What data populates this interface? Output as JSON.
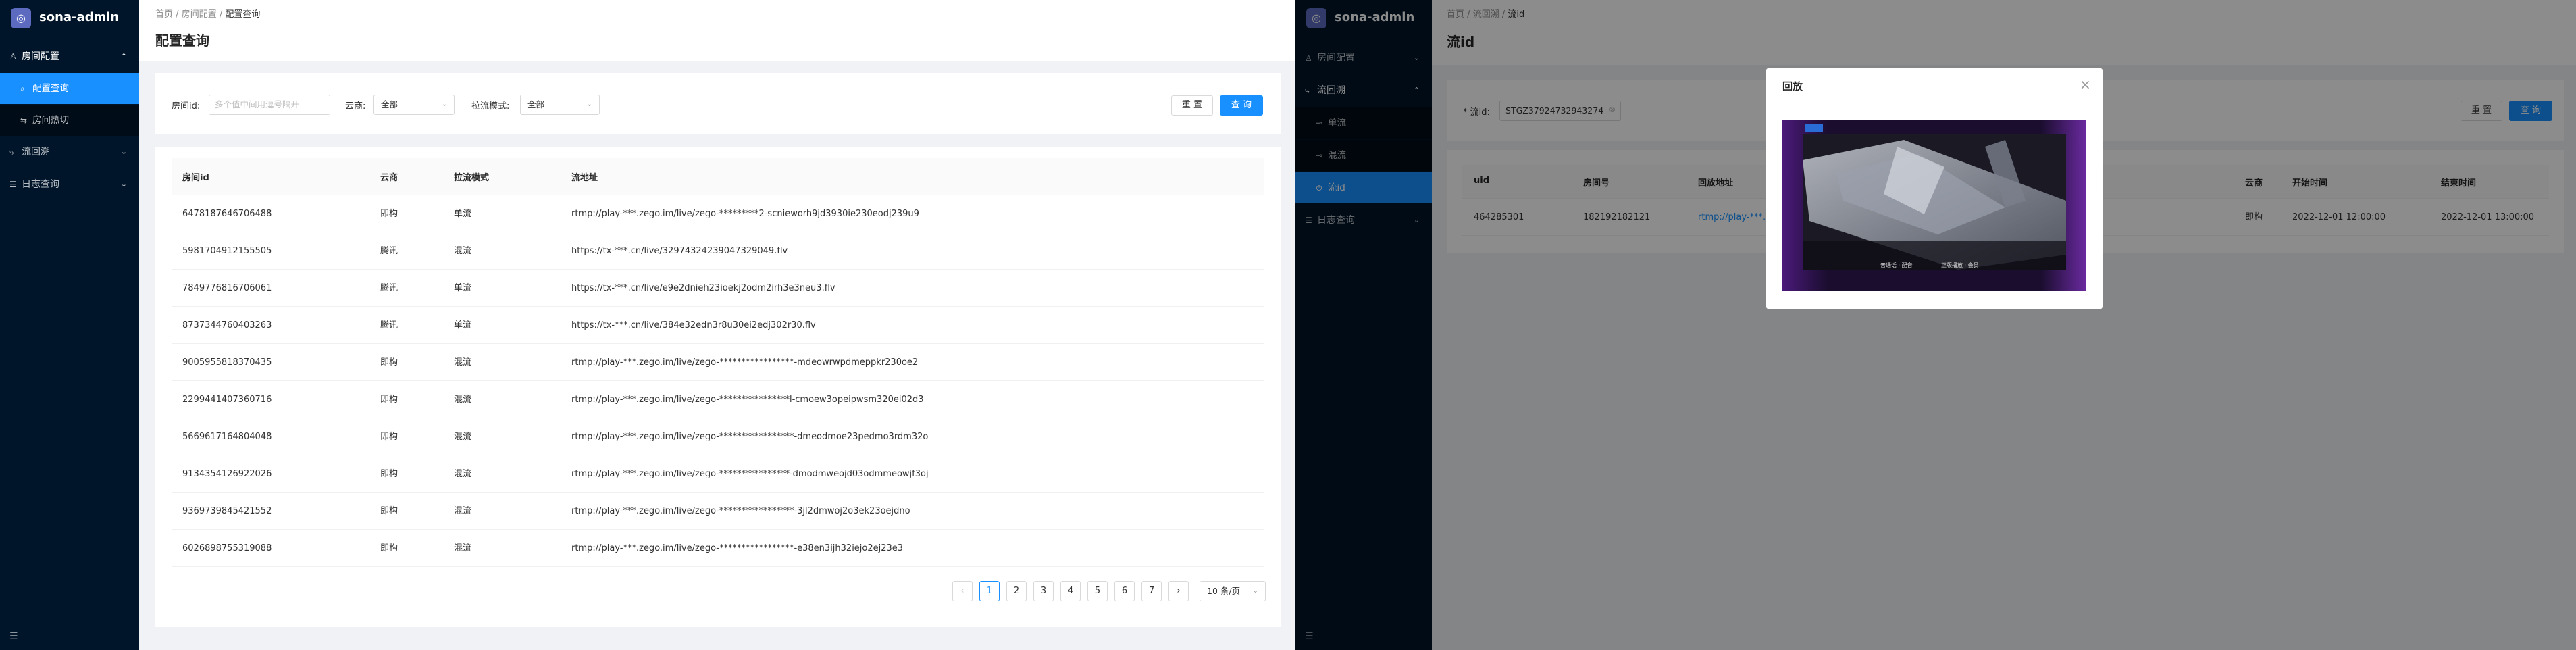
{
  "app": {
    "name": "sona-admin",
    "logo_glyph": "◎"
  },
  "left": {
    "menu": [
      {
        "label": "房间配置",
        "icon": "♙",
        "arrow": "⌃"
      },
      {
        "label": "配置查询",
        "icon": "⌕"
      },
      {
        "label": "房间热切",
        "icon": "⇆"
      },
      {
        "label": "流回溯",
        "icon": "⤷",
        "arrow": "⌄"
      },
      {
        "label": "日志查询",
        "icon": "☰",
        "arrow": "⌄"
      }
    ],
    "breadcrumb": {
      "home": "首页",
      "sep": "/",
      "section": "房间配置",
      "current": "配置查询"
    },
    "title": "配置查询",
    "filters": {
      "room_label": "房间id:",
      "room_placeholder": "多个值中间用逗号隔开",
      "cloud_label": "云商:",
      "cloud_value": "全部",
      "mode_label": "拉流模式:",
      "mode_value": "全部",
      "reset": "重 置",
      "search": "查 询"
    },
    "table": {
      "headers": [
        "房间id",
        "云商",
        "拉流模式",
        "流地址"
      ],
      "rows": [
        [
          "6478187646706488",
          "即构",
          "单流",
          "rtmp://play-***.zego.im/live/zego-*********2-scnieworh9jd3930ie230eodj239u9"
        ],
        [
          "5981704912155505",
          "腾讯",
          "混流",
          "https://tx-***.cn/live/3297432423904732904​9.flv"
        ],
        [
          "7849776816706061",
          "腾讯",
          "单流",
          "https://tx-***.cn/live/e9e2dnieh23ioekj2odm2irh3e3neu3.flv"
        ],
        [
          "8737344760403263",
          "腾讯",
          "单流",
          "https://tx-***.cn/live/384e32edn3r8u30ei2edj302r30.flv"
        ],
        [
          "9005955818370435",
          "即构",
          "混流",
          "rtmp://play-***.zego.im/live/zego-*****************-mdeowrwpdmeppkr230oe2"
        ],
        [
          "2299441407360716",
          "即构",
          "混流",
          "rtmp://play-***.zego.im/live/zego-****************l-cmoew3opeipwsm320ei02d3"
        ],
        [
          "5669617164804048",
          "即构",
          "混流",
          "rtmp://play-***.zego.im/live/zego-*****************-dmeodmoe23pedmo3rdm32o"
        ],
        [
          "9134354126922026",
          "即构",
          "混流",
          "rtmp://play-***.zego.im/live/zego-****************-dmodmweojd03odmmeowjf3oj"
        ],
        [
          "9369739845421552",
          "即构",
          "混流",
          "rtmp://play-***.zego.im/live/zego-*****************-3jl2dmwoj2o3ek23oejdno"
        ],
        [
          "6026898755319088",
          "即构",
          "混流",
          "rtmp://play-***.zego.im/live/zego-*****************-e38en3ijh32iejo2ej23e3"
        ]
      ]
    },
    "pagination": {
      "prev": "‹",
      "next": "›",
      "pages": [
        "1",
        "2",
        "3",
        "4",
        "5",
        "6",
        "7"
      ],
      "current": "1",
      "page_size": "10 条/页"
    },
    "collapse_icon": "☰"
  },
  "right": {
    "menu": [
      {
        "label": "房间配置",
        "icon": "♙",
        "arrow": "⌄"
      },
      {
        "label": "流回溯",
        "icon": "⤷",
        "arrow": "⌃"
      },
      {
        "label": "单流",
        "icon": "⊸"
      },
      {
        "label": "混流",
        "icon": "⊸"
      },
      {
        "label": "流id",
        "icon": "⊚"
      },
      {
        "label": "日志查询",
        "icon": "☰",
        "arrow": "⌄"
      }
    ],
    "breadcrumb": {
      "home": "首页",
      "sep": "/",
      "section": "流回溯",
      "current": "流id"
    },
    "title": "流id",
    "filters": {
      "stream_label": "* 流id:",
      "stream_value": "STGZ37924732943274",
      "reset": "重 置",
      "search": "查 询"
    },
    "table": {
      "headers": [
        "uid",
        "房间号",
        "回放地址",
        "云商",
        "开始时间",
        "结束时间"
      ],
      "row": [
        "464285301",
        "182192182121",
        "rtmp://play-***.zego.",
        "即构",
        "2022-12-01 12:00:00",
        "2022-12-01 13:00:00"
      ]
    },
    "modal": {
      "title": "回放",
      "close": "×",
      "subtitle_left": "普通话 · 配音",
      "subtitle_right": "正版播放 · 会员"
    },
    "collapse_icon": "☰"
  },
  "colors": {
    "sidebar": "#001529",
    "primary": "#1890ff",
    "link": "#1890ff"
  }
}
